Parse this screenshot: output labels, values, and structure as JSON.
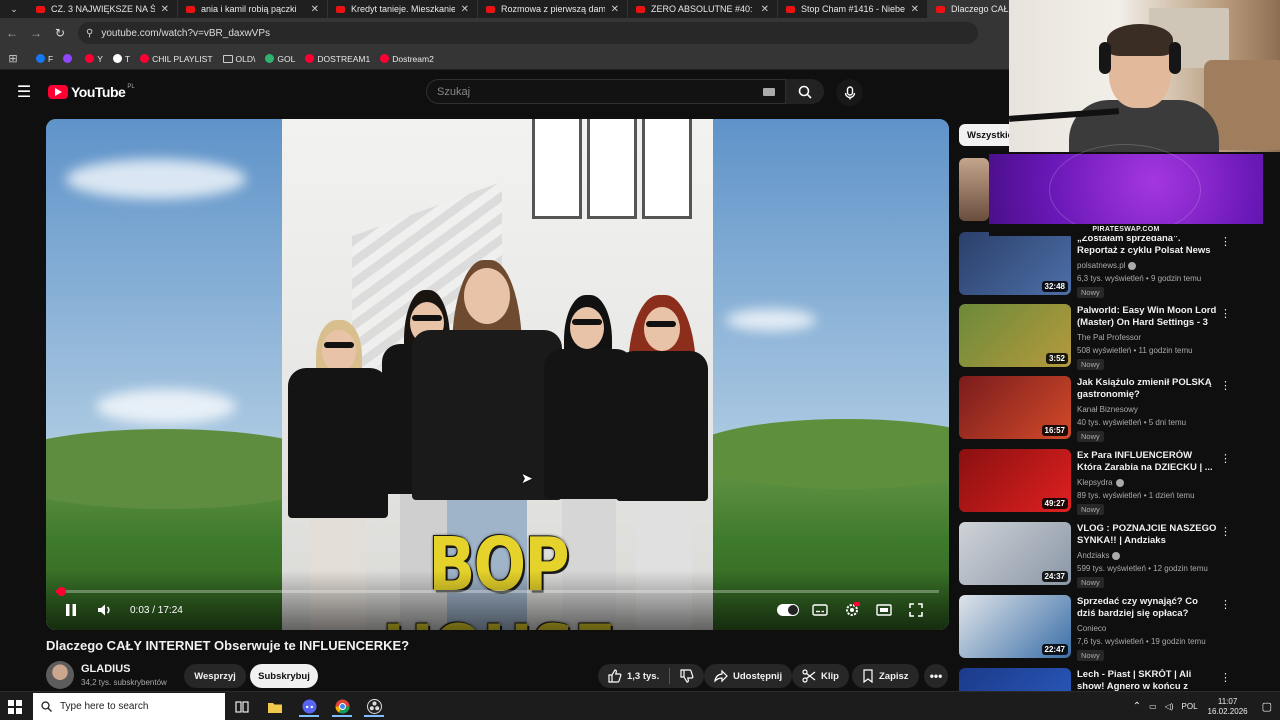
{
  "browser": {
    "tabs": [
      {
        "title": "CZ. 3 NAJWIĘKSZE NA ŚW",
        "active": false
      },
      {
        "title": "ania i kamil robią pączki",
        "active": false
      },
      {
        "title": "Kredyt tanieje. Mieszkanie",
        "active": false
      },
      {
        "title": "Rozmowa z pierwszą dam",
        "active": false
      },
      {
        "title": "ZERO ABSOLUTNE #40: M",
        "active": false
      },
      {
        "title": "Stop Cham #1416 - Niebe",
        "active": false
      },
      {
        "title": "Dlaczego CAŁY INTER",
        "active": true
      }
    ],
    "url": "youtube.com/watch?v=vBR_daxwVPs",
    "bookmarks": [
      {
        "label": "F",
        "color": "#1877f2"
      },
      {
        "label": "",
        "color": "#9146ff"
      },
      {
        "label": "Y",
        "color": "#ff0033"
      },
      {
        "label": "T",
        "color": "#ffffff"
      },
      {
        "label": "CHIL PLAYLIST",
        "color": "#ff0033"
      },
      {
        "label": "OLD\\",
        "color": "#cccccc"
      },
      {
        "label": "GOL",
        "color": "#2fb36e"
      },
      {
        "label": "DOSTREAM1",
        "color": "#ff0033"
      },
      {
        "label": "Dostream2",
        "color": "#ff0033"
      }
    ]
  },
  "youtube": {
    "logo_text": "YouTube",
    "logo_region": "PL",
    "search_placeholder": "Szukaj",
    "player": {
      "caption": "BOP HOUSE",
      "time": "0:03 / 17:24",
      "progress": 0.003
    },
    "video_title": "Dlaczego CAŁY INTERNET Obserwuje te INFLUENCERKE?",
    "channel": {
      "name": "GLADIUS",
      "subscribers": "34,2 tys. subskrybentów"
    },
    "buttons": {
      "join": "Wesprzyj",
      "subscribe": "Subskrybuj",
      "likes": "1,3 tys.",
      "share": "Udostępnij",
      "clip": "Klip",
      "save": "Zapisz"
    },
    "chip": "Wszystkie",
    "recommendations": [
      {
        "title": "„Zostałam sprzedana”. Reportaż z cyklu Polsat News Ujawnia",
        "channel": "polsatnews.pl",
        "verified": true,
        "meta": "6,3 tys. wyświetleń • 9 godzin temu",
        "badge": "Nowy",
        "duration": "32:48",
        "thumb": [
          "#2b3f6a",
          "#4d6fa8"
        ]
      },
      {
        "title": "Palworld: Easy Win Moon Lord (Master) On Hard Settings - 3 ...",
        "channel": "The Pal Professor",
        "verified": false,
        "meta": "508 wyświetleń • 11 godzin temu",
        "badge": "Nowy",
        "duration": "3:52",
        "thumb": [
          "#6c8a3a",
          "#b59a3c"
        ]
      },
      {
        "title": "Jak Książulo zmienił POLSKĄ gastronomię?",
        "channel": "Kanał Biznesowy",
        "verified": false,
        "meta": "40 tys. wyświetleń • 5 dni temu",
        "badge": "Nowy",
        "duration": "16:57",
        "thumb": [
          "#7a1c1c",
          "#d24a2a"
        ]
      },
      {
        "title": "Ex Para INFLUENCERÓW Która Zarabia na DZIECKU | ...",
        "channel": "Klepsydra",
        "verified": true,
        "meta": "89 tys. wyświetleń • 1 dzień temu",
        "badge": "Nowy",
        "duration": "49:27",
        "thumb": [
          "#8a1010",
          "#e02020"
        ]
      },
      {
        "title": "VLOG : POZNAJCIE NASZEGO SYNKA!! | Andziaks",
        "channel": "Andziaks",
        "verified": true,
        "meta": "599 tys. wyświetleń • 12 godzin temu",
        "badge": "Nowy",
        "duration": "24:37",
        "thumb": [
          "#cfd3d8",
          "#8a96a6"
        ]
      },
      {
        "title": "Sprzedać czy wynająć? Co dziś bardziej się opłaca?",
        "channel": "Conieco",
        "verified": false,
        "meta": "7,6 tys. wyświetleń • 19 godzin temu",
        "badge": "Nowy",
        "duration": "22:47",
        "thumb": [
          "#dfe4e8",
          "#3a6ea8"
        ]
      },
      {
        "title": "Lech - Piast | SKRÓT | Ali show! Agnero w końcu z golem! | ...",
        "channel": "",
        "verified": false,
        "meta": "",
        "badge": "",
        "duration": "",
        "thumb": [
          "#1c3a8a",
          "#2a5cc0"
        ]
      }
    ]
  },
  "overlay": {
    "promo_label": "PIRATESWAP.COM"
  },
  "taskbar": {
    "search_placeholder": "Type here to search",
    "lang": "POL",
    "time": "11:07",
    "date": "16.02.2026"
  }
}
